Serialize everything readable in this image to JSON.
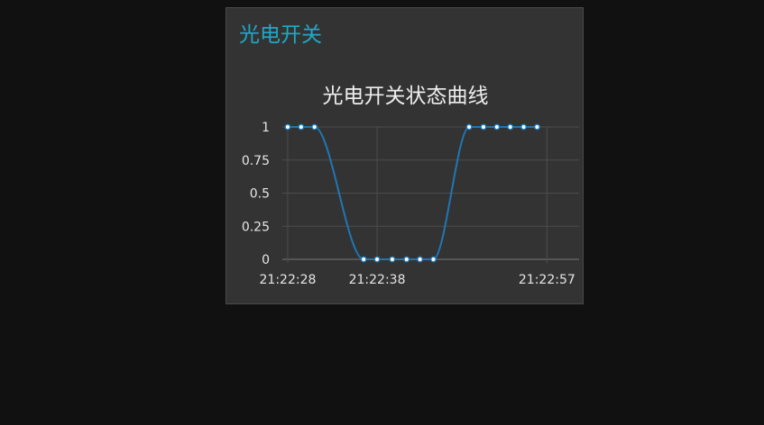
{
  "card": {
    "title": "光电开关"
  },
  "colors": {
    "page_background": "#111111",
    "card_background": "#333333",
    "title_accent": "#1fa9c7",
    "series_line": "#1f77b4",
    "point_fill": "#ffffff",
    "grid": "#4d4d4d"
  },
  "chart_data": {
    "type": "line",
    "title": "光电开关状态曲线",
    "xlabel": "",
    "ylabel": "",
    "x_tick_labels": [
      "21:22:28",
      "21:22:38",
      "21:22:57"
    ],
    "x_tick_values": [
      0,
      10,
      29
    ],
    "y_tick_labels": [
      "1",
      "0.75",
      "0.5",
      "0.25",
      "0"
    ],
    "y_tick_values": [
      1,
      0.75,
      0.5,
      0.25,
      0
    ],
    "xlim": [
      -0.6,
      32.6
    ],
    "ylim": [
      0,
      1
    ],
    "grid": true,
    "legend": "none",
    "series": [
      {
        "x": [
          0,
          1.5,
          3,
          8.5,
          10,
          11.7,
          13.3,
          14.8,
          16.3,
          20.3,
          21.9,
          23.4,
          24.9,
          26.4,
          27.9
        ],
        "values": [
          1,
          1,
          1,
          0,
          0,
          0,
          0,
          0,
          0,
          1,
          1,
          1,
          1,
          1,
          1
        ]
      }
    ]
  }
}
